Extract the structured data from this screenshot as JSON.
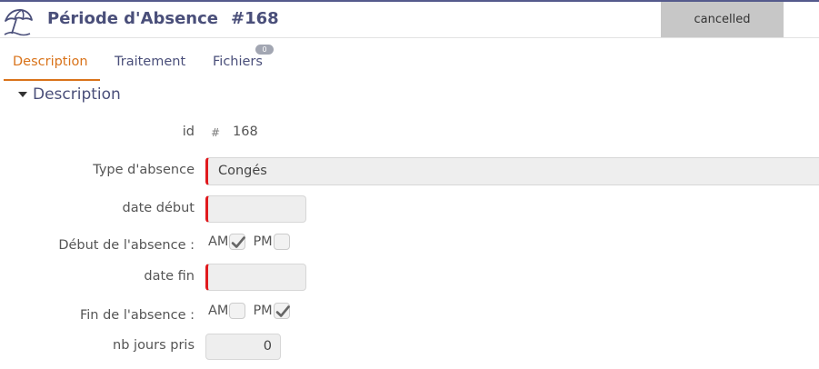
{
  "header": {
    "title": "Période d'Absence",
    "record_number": "#168",
    "status": "cancelled",
    "icon": "beach-umbrella-icon"
  },
  "tabs": [
    {
      "label": "Description",
      "active": true
    },
    {
      "label": "Traitement",
      "active": false
    },
    {
      "label": "Fichiers",
      "active": false,
      "count": "0"
    }
  ],
  "section": {
    "title": "Description",
    "expanded": true
  },
  "form": {
    "id": {
      "label": "id",
      "prefix": "#",
      "value": "168"
    },
    "type_absence": {
      "label": "Type d'absence",
      "value": "Congés",
      "required": true
    },
    "date_debut": {
      "label": "date début",
      "value": "",
      "required": true
    },
    "debut_absence": {
      "label": "Début de l'absence :",
      "am": {
        "label": "AM",
        "checked": true
      },
      "pm": {
        "label": "PM",
        "checked": false
      }
    },
    "date_fin": {
      "label": "date fin",
      "value": "",
      "required": true
    },
    "fin_absence": {
      "label": "Fin de l'absence :",
      "am": {
        "label": "AM",
        "checked": false
      },
      "pm": {
        "label": "PM",
        "checked": true
      }
    },
    "nb_jours": {
      "label": "nb jours pris",
      "value": "0"
    }
  },
  "colors": {
    "accent": "#d9731a",
    "title": "#4a4f7a",
    "required": "#e0191d",
    "status_bg": "#c7c7c7"
  }
}
